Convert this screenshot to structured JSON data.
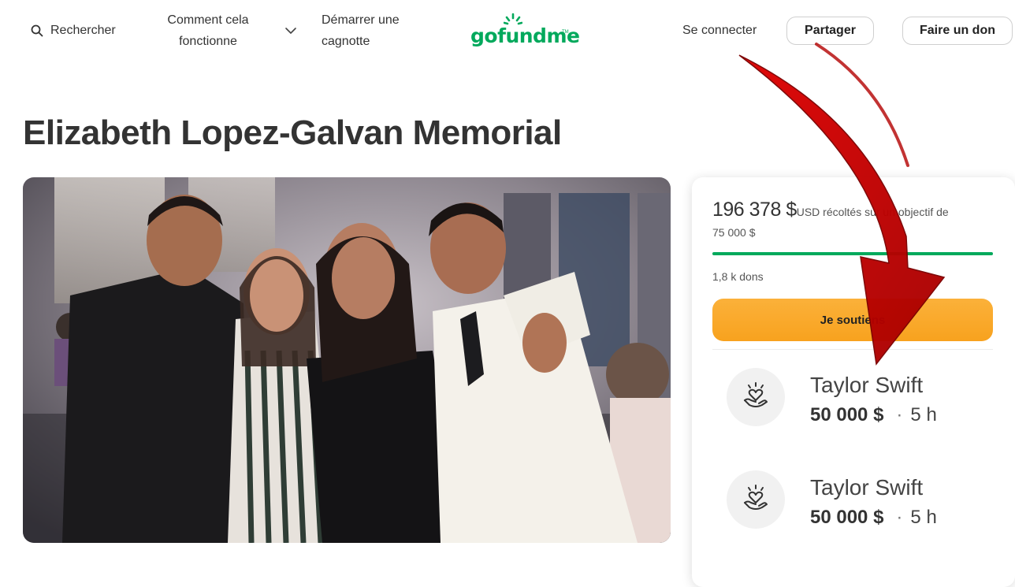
{
  "header": {
    "search_label": "Rechercher",
    "how_label": "Comment cela fonctionne",
    "start_label": "Démarrer une cagnotte",
    "logo_text": "gofundme",
    "signin_label": "Se connecter",
    "share_label": "Partager",
    "donate_label": "Faire un don"
  },
  "page": {
    "title": "Elizabeth Lopez-Galvan Memorial"
  },
  "card": {
    "raised_amount": "196 378 $",
    "raised_text": "USD récoltés sur un objectif de",
    "goal": "75 000 $",
    "progress_fraction": 1.0,
    "donations_count": "1,8 k dons",
    "support_label": "Je soutiens",
    "donors": [
      {
        "name": "Taylor Swift",
        "amount": "50 000 $",
        "dot": "·",
        "time": "5 h"
      },
      {
        "name": "Taylor Swift",
        "amount": "50 000 $",
        "dot": "·",
        "time": "5 h"
      }
    ]
  },
  "colors": {
    "brand_green": "#02a95c",
    "support_orange": "#f8a21e",
    "arrow_red": "#c40000"
  }
}
